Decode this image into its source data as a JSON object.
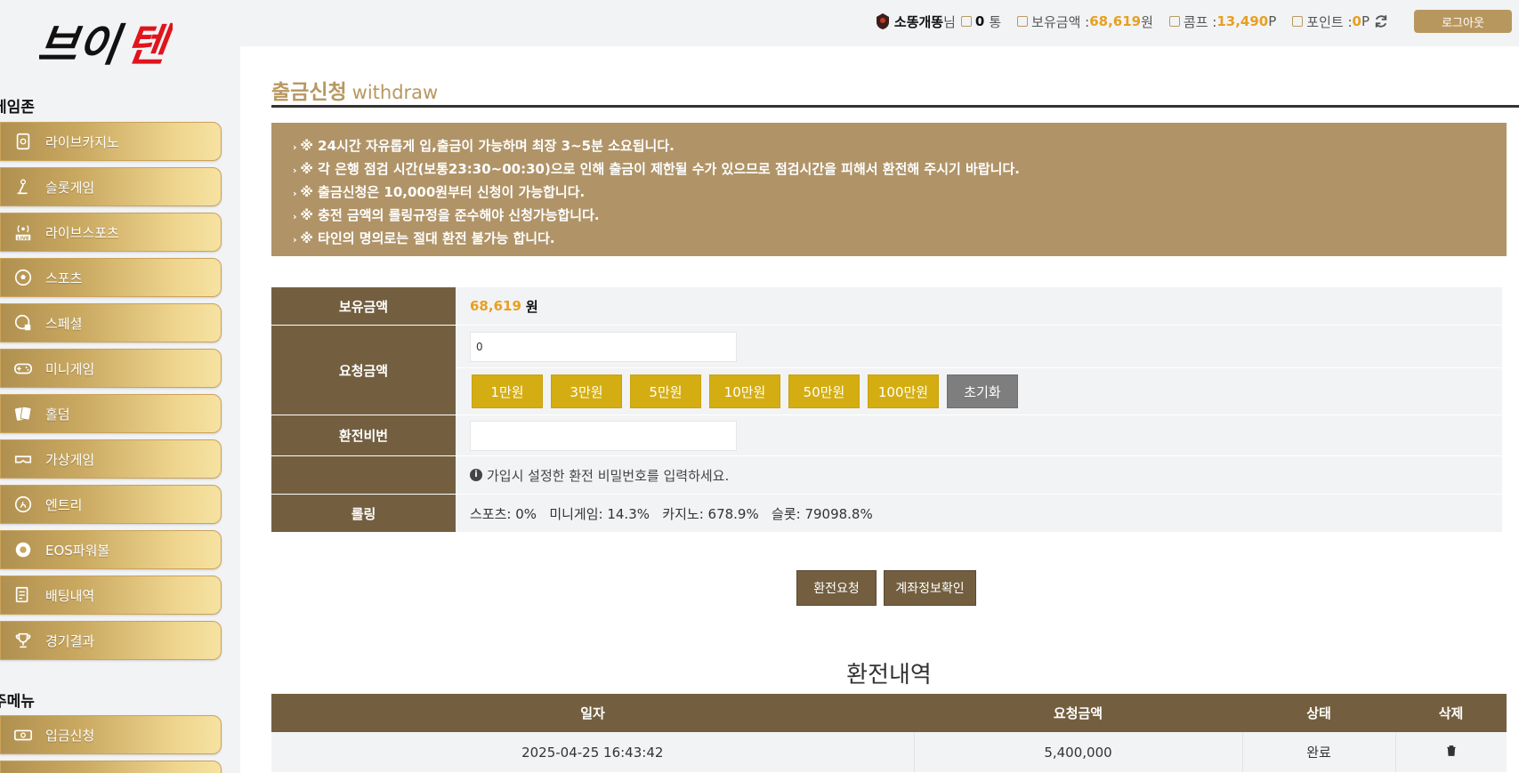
{
  "logo": {
    "text": "브이텐"
  },
  "sidebar": {
    "game_zone_title": "게임존",
    "items": [
      {
        "label": "라이브카지노",
        "icon": "casino-chip-icon"
      },
      {
        "label": "슬롯게임",
        "icon": "slot-lever-icon"
      },
      {
        "label": "라이브스포츠",
        "icon": "live-broadcast-icon"
      },
      {
        "label": "스포츠",
        "icon": "soccer-ball-icon"
      },
      {
        "label": "스페셜",
        "icon": "special-ball-icon"
      },
      {
        "label": "미니게임",
        "icon": "gamepad-icon"
      },
      {
        "label": "홀덤",
        "icon": "playing-cards-icon"
      },
      {
        "label": "가상게임",
        "icon": "vr-headset-icon"
      },
      {
        "label": "엔트리",
        "icon": "entry-runner-icon"
      },
      {
        "label": "EOS파워볼",
        "icon": "powerball-icon"
      },
      {
        "label": "배팅내역",
        "icon": "betting-list-icon"
      },
      {
        "label": "경기결과",
        "icon": "trophy-icon"
      }
    ],
    "main_menu_title": "주메뉴",
    "main_items": [
      {
        "label": "입금신청",
        "icon": "deposit-money-icon"
      }
    ]
  },
  "topbar": {
    "username": "소똥개똥",
    "user_suffix": "님",
    "messages_count": "0",
    "messages_unit": "통",
    "balance_label": "보유금액 : ",
    "balance_value": "68,619",
    "balance_unit": "원",
    "comp_label": "콤프 : ",
    "comp_value": "13,490",
    "comp_unit": "P",
    "point_label": "포인트 : ",
    "point_value": "0",
    "point_unit": "P",
    "logout": "로그아웃"
  },
  "page": {
    "title": "출금신청",
    "title_en": "withdraw"
  },
  "notice": [
    "※ 24시간 자유롭게 입,출금이 가능하며 최장 3~5분 소요됩니다.",
    "※ 각 은행 점검 시간(보통23:30~00:30)으로 인해 출금이 제한될 수가 있으므로 점검시간을 피해서 환전해 주시기 바랍니다.",
    "※ 출금신청은 10,000원부터 신청이 가능합니다.",
    "※ 충전 금액의 롤링규정을 준수해야 신청가능합니다.",
    "※ 타인의 명의로는 절대 환전 불가능 합니다."
  ],
  "form": {
    "balance_label": "보유금액",
    "balance_value": "68,619",
    "balance_unit": "원",
    "request_label": "요청금액",
    "request_value": "0",
    "amount_buttons": [
      "1만원",
      "3만원",
      "5만원",
      "10만원",
      "50만원",
      "100만원"
    ],
    "reset": "초기화",
    "password_label": "환전비번",
    "password_value": "",
    "password_hint": "가입시 설정한 환전 비밀번호를 입력하세요.",
    "rolling_label": "롤링",
    "rolling_value": "스포츠: 0%   미니게임: 14.3%   카지노: 678.9%   슬롯: 79098.8%"
  },
  "actions": {
    "request": "환전요청",
    "account_check": "계좌정보확인"
  },
  "history": {
    "title": "환전내역",
    "columns": [
      "일자",
      "요청금액",
      "상태",
      "삭제"
    ],
    "rows": [
      {
        "date": "2025-04-25 16:43:42",
        "amount": "5,400,000",
        "status": "완료"
      }
    ]
  },
  "colors": {
    "gold_accent": "#b8975f",
    "brown_header": "#735f40",
    "amount_button": "#d4ad12",
    "orange_value": "#e8a020",
    "logo_red": "#e0141c"
  }
}
